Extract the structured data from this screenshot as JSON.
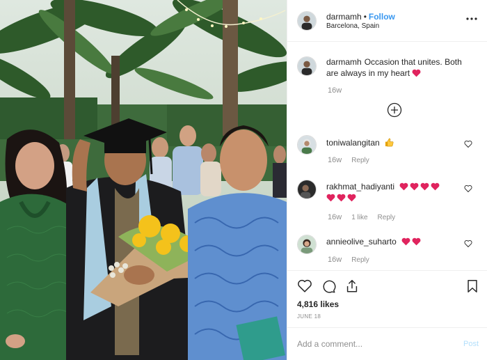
{
  "colors": {
    "link": "#3897f0",
    "muted": "#8e8e8e",
    "heart": "#e0245e",
    "post_disabled": "#b2dffc"
  },
  "header": {
    "username": "darmamh",
    "separator": "•",
    "follow_label": "Follow",
    "location": "Barcelona, Spain",
    "more_icon": "more-options-icon"
  },
  "caption": {
    "username": "darmamh",
    "text": "Occasion that unites. Both are always in my heart",
    "emoji": "red-heart",
    "time": "16w"
  },
  "load_more_icon": "plus-circle-icon",
  "comments": [
    {
      "username": "toniwalangitan",
      "text": "",
      "emoji": [
        "thumbs-up"
      ],
      "time": "16w",
      "likes": "",
      "reply_label": "Reply"
    },
    {
      "username": "rakhmat_hadiyanti",
      "text": "",
      "emoji": [
        "red-heart",
        "red-heart",
        "red-heart",
        "red-heart",
        "red-heart",
        "red-heart",
        "red-heart"
      ],
      "time": "16w",
      "likes": "1 like",
      "reply_label": "Reply"
    },
    {
      "username": "annieolive_suharto",
      "text": "",
      "emoji": [
        "red-heart",
        "red-heart"
      ],
      "time": "16w",
      "likes": "",
      "reply_label": "Reply"
    }
  ],
  "actions": {
    "icons": [
      "heart-icon",
      "comment-icon",
      "share-icon",
      "bookmark-icon"
    ],
    "likes": "4,816 likes",
    "date": "JUNE 18"
  },
  "add_comment": {
    "placeholder": "Add a comment...",
    "post_label": "Post"
  }
}
